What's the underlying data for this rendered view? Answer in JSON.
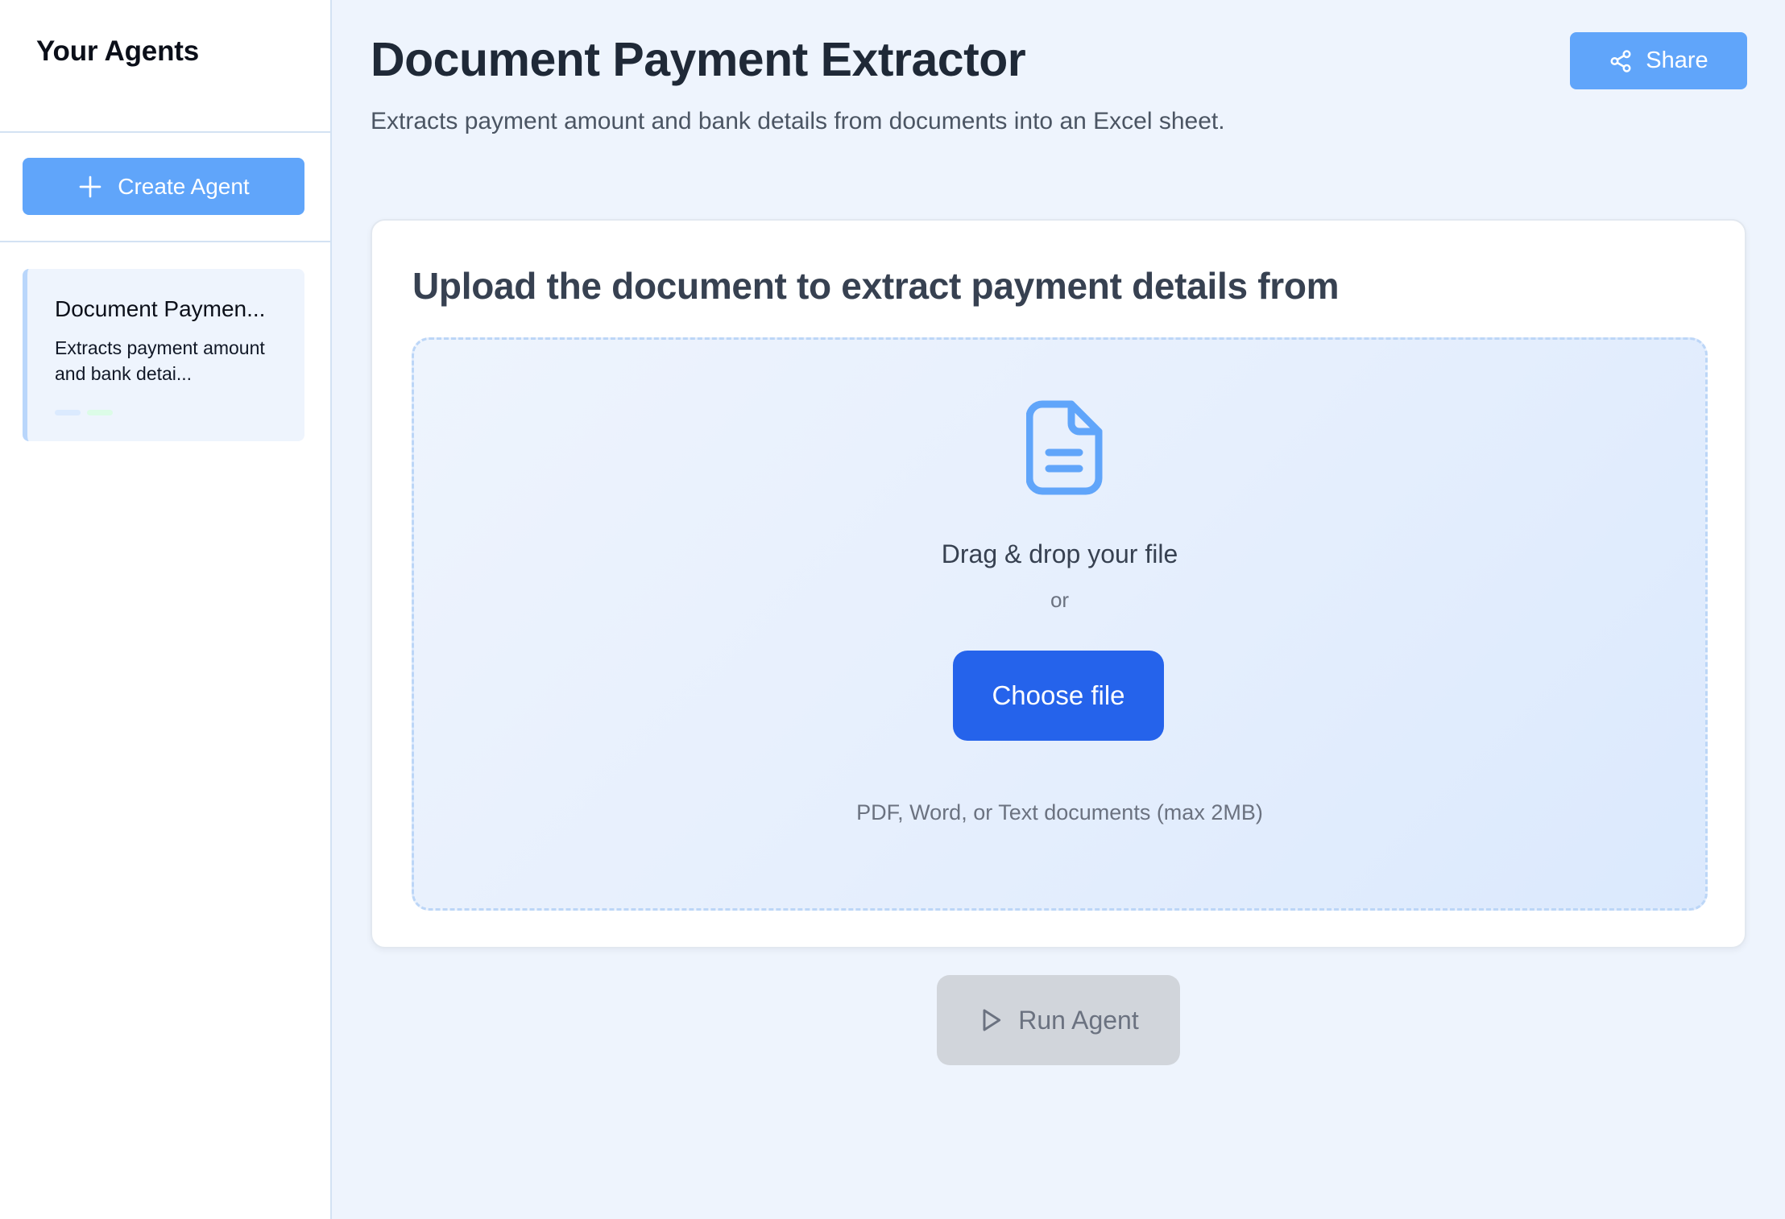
{
  "sidebar": {
    "title": "Your Agents",
    "create_button": {
      "label": "Create Agent",
      "icon": "plus-icon"
    },
    "agents": [
      {
        "title": "Document Paymen...",
        "description": "Extracts payment amount and bank detai...",
        "selected": true
      }
    ]
  },
  "header": {
    "title": "Document Payment Extractor",
    "subtitle": "Extracts payment amount and bank details from documents into an Excel sheet.",
    "share_button": {
      "label": "Share",
      "icon": "share-icon"
    }
  },
  "upload": {
    "heading": "Upload the document to extract payment details from",
    "icon": "document-icon",
    "drop_text": "Drag & drop your file",
    "or_text": "or",
    "choose_button": "Choose file",
    "formats_text": "PDF, Word, or Text documents (max 2MB)"
  },
  "run_button": {
    "label": "Run Agent",
    "icon": "play-icon",
    "disabled": true
  },
  "colors": {
    "accent": "#60a5fa",
    "primary": "#2563eb",
    "background": "#eef4fd",
    "disabled": "#d1d5db"
  }
}
